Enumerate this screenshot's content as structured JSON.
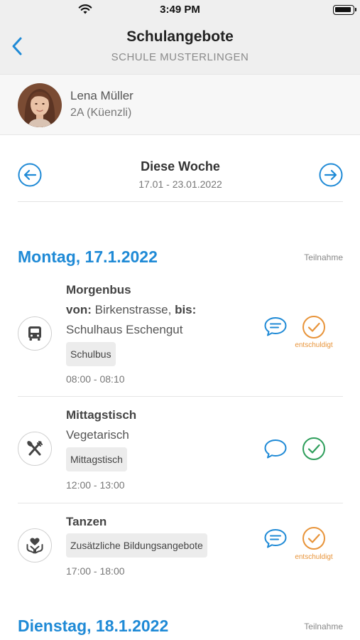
{
  "status_bar": {
    "time": "3:49 PM",
    "wifi_icon": "wifi-icon",
    "battery_icon": "battery-icon"
  },
  "nav": {
    "title": "Schulangebote",
    "subtitle": "SCHULE MUSTERLINGEN",
    "back_icon": "chevron-left-icon"
  },
  "student": {
    "name": "Lena Müller",
    "class": "2A (Küenzli)"
  },
  "week": {
    "label": "Diese Woche",
    "range": "17.01 - 23.01.2022",
    "prev_icon": "arrow-left-circle-icon",
    "next_icon": "arrow-right-circle-icon"
  },
  "colors": {
    "accent": "#1f8ad6",
    "excused": "#e8943a",
    "present": "#2e9e5b",
    "divider": "#e6e6e6"
  },
  "days": [
    {
      "date": "Montag, 17.1.2022",
      "participation_label": "Teilnahme",
      "entries": [
        {
          "title": "Morgenbus",
          "from_label": "von:",
          "from": "Birkenstrasse,",
          "to_label": "bis:",
          "to": "Schulhaus Eschengut",
          "tag": "Schulbus",
          "time": "08:00 - 08:10",
          "icon": "bus-icon",
          "status": "excused",
          "status_label": "entschuldigt"
        },
        {
          "title": "Mittagstisch",
          "subtitle": "Vegetarisch",
          "tag": "Mittagstisch",
          "time": "12:00 - 13:00",
          "icon": "cutlery-icon",
          "status": "present"
        },
        {
          "title": "Tanzen",
          "tag": "Zusätzliche Bildungsangebote",
          "time": "17:00 - 18:00",
          "icon": "heart-hands-icon",
          "status": "excused",
          "status_label": "entschuldigt"
        }
      ]
    },
    {
      "date": "Dienstag, 18.1.2022",
      "participation_label": "Teilnahme",
      "entries": []
    }
  ]
}
